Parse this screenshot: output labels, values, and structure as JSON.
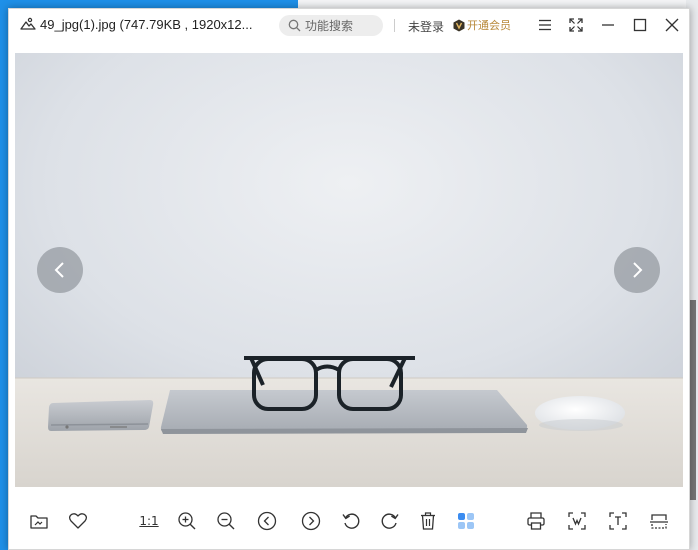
{
  "window": {
    "title": "49_jpg(1).jpg (747.79KB , 1920x12...",
    "search_placeholder": "功能搜索",
    "login_label": "未登录",
    "vip_label": "开通会员"
  },
  "toolbar": {
    "actual_size_label": "1:1",
    "active_color": "#3b8cf0"
  },
  "colors": {
    "vip": "#b8893a",
    "nav_button": "#999ca2"
  },
  "icons": [
    "album-icon",
    "search-icon",
    "vip-badge-icon",
    "menu-icon",
    "fullscreen-icon",
    "minimize-icon",
    "maximize-icon",
    "close-icon",
    "prev-arrow-icon",
    "next-arrow-icon",
    "open-folder-icon",
    "heart-icon",
    "zoom-in-icon",
    "zoom-out-icon",
    "prev-image-icon",
    "next-image-icon",
    "rotate-left-icon",
    "rotate-right-icon",
    "delete-icon",
    "thumbnails-icon",
    "print-icon",
    "crop-icon",
    "ocr-icon",
    "scan-icon"
  ]
}
